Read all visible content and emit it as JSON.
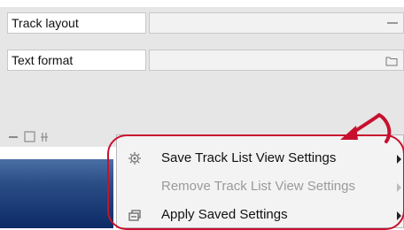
{
  "properties": {
    "rows": [
      {
        "label": "Track layout",
        "value_icon": "collapse-dash-icon"
      },
      {
        "label": "Text format",
        "value_icon": "folder-icon"
      }
    ]
  },
  "toolbar": {
    "icons": [
      "minimize-icon",
      "restore-icon",
      "split-icon"
    ]
  },
  "context_menu": {
    "items": [
      {
        "label": "Save Track List View Settings",
        "icon": "save-settings-icon",
        "enabled": true,
        "has_submenu": true
      },
      {
        "label": "Remove Track List View Settings",
        "icon": "none",
        "enabled": false,
        "has_submenu": true
      },
      {
        "label": "Apply Saved Settings",
        "icon": "apply-settings-icon",
        "enabled": true,
        "has_submenu": true
      }
    ]
  },
  "annotation": {
    "color": "#c8102e"
  }
}
